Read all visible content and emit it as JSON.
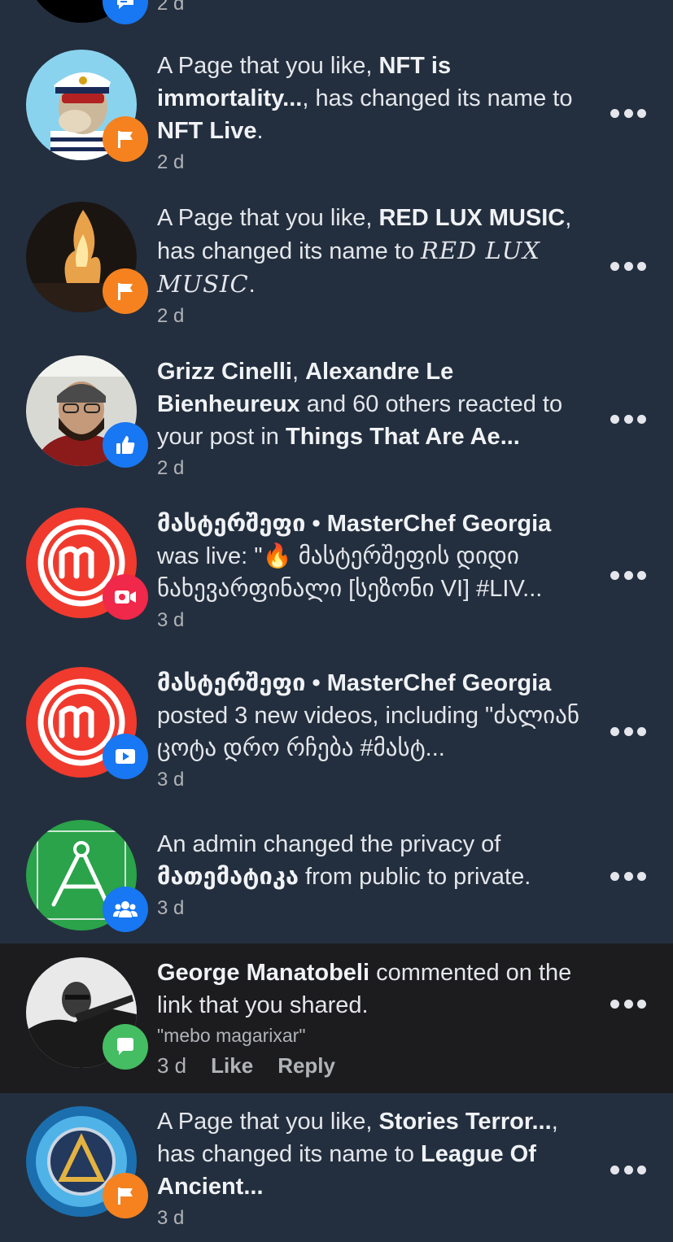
{
  "notifications": [
    {
      "pre": "",
      "bold1": "",
      "mid": "",
      "bold2": "",
      "post": "",
      "time": "2 d"
    },
    {
      "pre": "A Page that you like, ",
      "bold1": "NFT is immortality...",
      "mid": ", has changed its name to ",
      "bold2": "NFT Live",
      "post": ".",
      "time": "2 d",
      "badge": "flag-icon",
      "badge_color": "#f5821f"
    },
    {
      "pre": "A Page that you like, ",
      "bold1": "RED LUX MUSIC",
      "mid": ", has changed its name to ",
      "bold2": "𝑅𝐸𝐷 𝐿𝑈𝑋 𝑀𝑈𝑆𝐼𝐶",
      "post": ".",
      "time": "2 d",
      "badge": "flag-icon",
      "badge_color": "#f5821f"
    },
    {
      "bold1": "Grizz Cinelli",
      "sep": ", ",
      "bold1b": "Alexandre Le Bienheureux",
      "mid": " and 60 others reacted to your post in ",
      "bold2": "Things That Are Ae...",
      "time": "2 d",
      "badge": "thumbs-up-icon",
      "badge_color": "#1877f2"
    },
    {
      "bold1": "მასტერშეფი • MasterChef Georgia",
      "mid": " was live: \"🔥 მასტერშეფის დიდი ნახევარფინალი [სეზონი VI] #LIV...",
      "time": "3 d",
      "badge": "live-video-icon",
      "badge_color": "#f02849"
    },
    {
      "bold1": "მასტერშეფი • MasterChef Georgia",
      "mid": " posted 3 new videos, including \"ძალიან ცოტა დრო რჩება #მასტ...",
      "time": "3 d",
      "badge": "video-play-icon",
      "badge_color": "#1877f2"
    },
    {
      "pre": "An admin changed the privacy of ",
      "bold1": "მათემატიკა",
      "mid": " from public to private.",
      "time": "3 d",
      "badge": "group-icon",
      "badge_color": "#1877f2"
    },
    {
      "bold1": "George Manatobeli",
      "mid": " commented on the link that you shared.",
      "comment": "\"mebo magarixar\"",
      "time": "3 d",
      "like_label": "Like",
      "reply_label": "Reply",
      "badge": "comment-bubble-icon",
      "badge_color": "#45bd62"
    },
    {
      "pre": "A Page that you like, ",
      "bold1": "Stories Terror...",
      "mid": ", has changed its name to ",
      "bold2": "League Of Ancient...",
      "time": "3 d",
      "badge": "flag-icon",
      "badge_color": "#f5821f"
    }
  ],
  "colors": {
    "background": "#232f3e",
    "highlight_row": "#1c1c1e",
    "text": "#e4e6eb",
    "secondary_text": "#b0b3b8"
  }
}
